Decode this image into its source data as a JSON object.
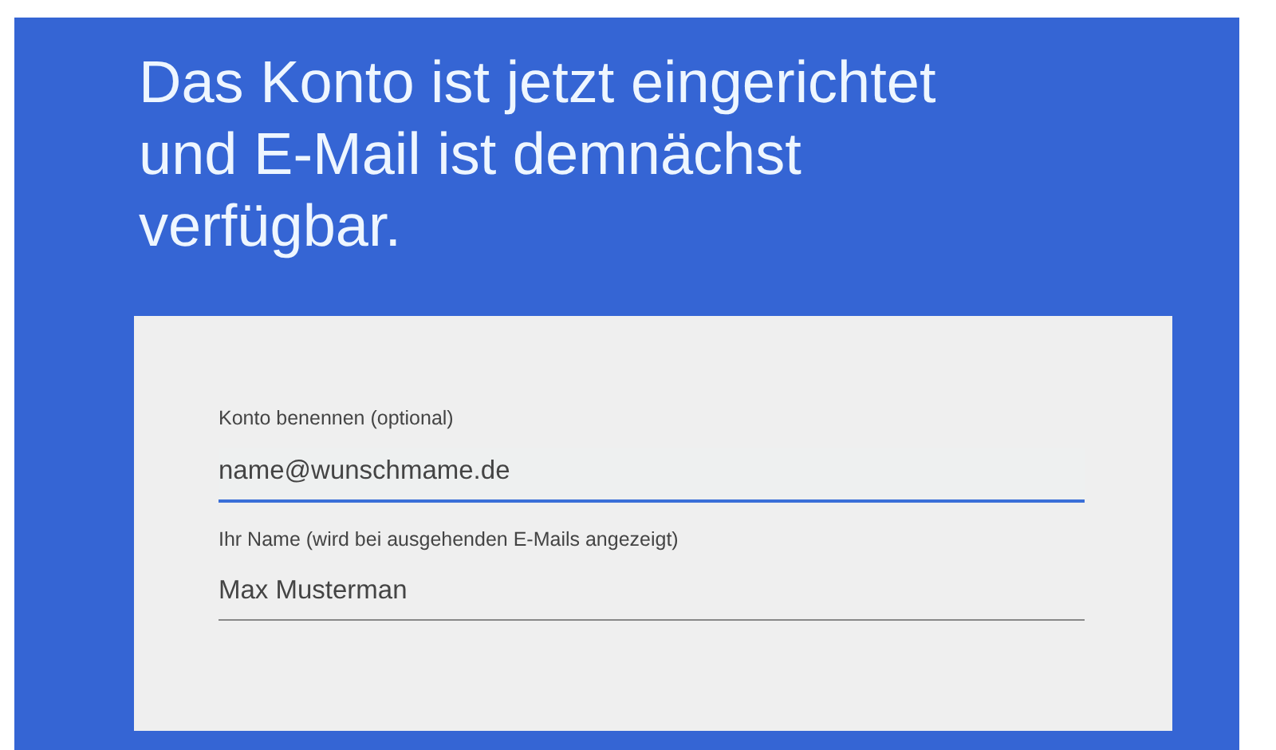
{
  "heading": "Das Konto ist jetzt eingerichtet und E-Mail ist demnächst verfügbar.",
  "fields": [
    {
      "label": "Konto benennen (optional)",
      "value": "name@wunschmame.de",
      "focused": true
    },
    {
      "label": "Ihr Name (wird bei ausgehenden E-Mails angezeigt)",
      "value": "Max Musterman",
      "focused": false
    }
  ]
}
